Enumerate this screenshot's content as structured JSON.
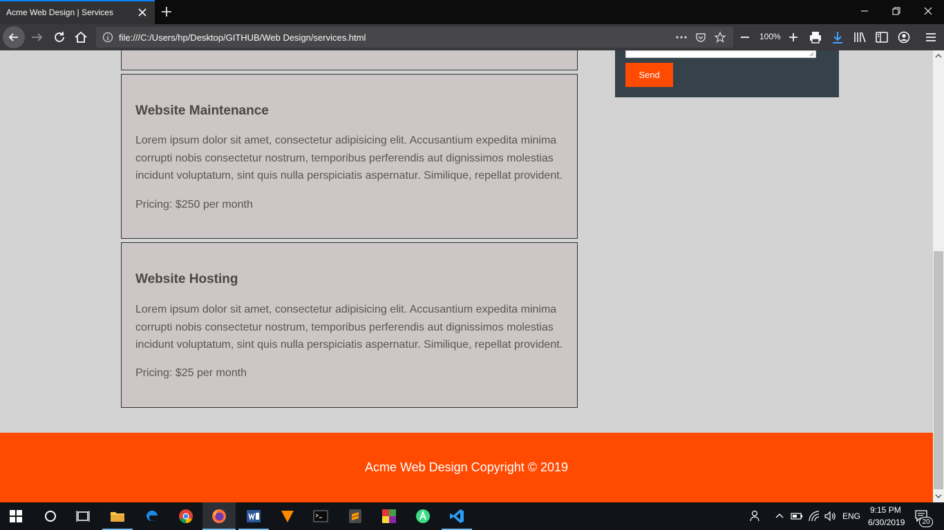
{
  "browser": {
    "tab_title": "Acme Web Design | Services",
    "url": "file:///C:/Users/hp/Desktop/GITHUB/Web Design/services.html",
    "zoom": "100%"
  },
  "sidebar": {
    "send_label": "Send"
  },
  "services": [
    {
      "title": "Website Maintenance",
      "description": "Lorem ipsum dolor sit amet, consectetur adipisicing elit. Accusantium expedita minima corrupti nobis consectetur nostrum, temporibus perferendis aut dignissimos molestias incidunt voluptatum, sint quis nulla perspiciatis aspernatur. Similique, repellat provident.",
      "pricing": "Pricing: $250 per month"
    },
    {
      "title": "Website Hosting",
      "description": "Lorem ipsum dolor sit amet, consectetur adipisicing elit. Accusantium expedita minima corrupti nobis consectetur nostrum, temporibus perferendis aut dignissimos molestias incidunt voluptatum, sint quis nulla perspiciatis aspernatur. Similique, repellat provident.",
      "pricing": "Pricing: $25 per month"
    }
  ],
  "footer": {
    "text": "Acme Web Design Copyright © 2019"
  },
  "taskbar": {
    "language": "ENG",
    "time": "9:15 PM",
    "date": "6/30/2019",
    "notification_count": "20",
    "apps": [
      "start-icon",
      "cortana-icon",
      "task-view-icon",
      "file-explorer-icon",
      "edge-icon",
      "chrome-icon",
      "firefox-icon",
      "word-icon",
      "vlc-icon",
      "terminal-icon",
      "sublime-icon",
      "app-grid-icon",
      "android-studio-icon",
      "vscode-icon"
    ]
  },
  "colors": {
    "accent": "#ff4a02",
    "sidebar_bg": "#35424a",
    "card_bg": "#cdc6c6",
    "page_bg": "#d3d3d3"
  }
}
